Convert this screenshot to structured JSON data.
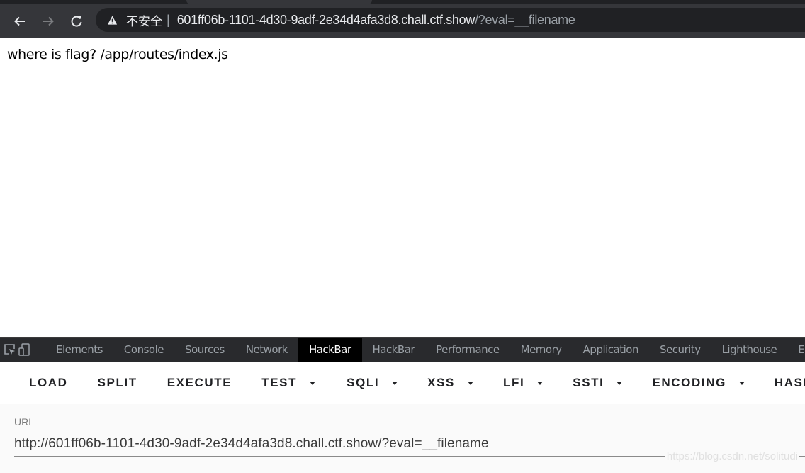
{
  "browser": {
    "security_label": "不安全",
    "separator": "|",
    "url_host": "601ff06b-1101-4d30-9adf-2e34d4afa3d8.chall.ctf.show",
    "url_rest": "/?eval=__filename",
    "icons": {
      "back": "arrow-left",
      "forward": "arrow-right",
      "reload": "refresh",
      "security": "warning-triangle"
    }
  },
  "page": {
    "text": "where is flag? /app/routes/index.js"
  },
  "devtools": {
    "tabs": [
      {
        "label": "Elements",
        "active": false
      },
      {
        "label": "Console",
        "active": false
      },
      {
        "label": "Sources",
        "active": false
      },
      {
        "label": "Network",
        "active": false
      },
      {
        "label": "HackBar",
        "active": true
      },
      {
        "label": "HackBar",
        "active": false
      },
      {
        "label": "Performance",
        "active": false
      },
      {
        "label": "Memory",
        "active": false
      },
      {
        "label": "Application",
        "active": false
      },
      {
        "label": "Security",
        "active": false
      },
      {
        "label": "Lighthouse",
        "active": false
      },
      {
        "label": "EditThisCookie",
        "active": false
      }
    ],
    "hackbar": {
      "buttons": [
        {
          "label": "LOAD"
        },
        {
          "label": "SPLIT"
        },
        {
          "label": "EXECUTE"
        },
        {
          "label": "TEST",
          "dropdown": true
        }
      ],
      "menus": [
        {
          "label": "SQLI",
          "dropdown": true
        },
        {
          "label": "XSS",
          "dropdown": true
        },
        {
          "label": "LFI",
          "dropdown": true
        },
        {
          "label": "SSTI",
          "dropdown": true
        },
        {
          "label": "ENCODING",
          "dropdown": true
        },
        {
          "label": "HASHING",
          "dropdown": true
        }
      ],
      "url_label": "URL",
      "url_value": "http://601ff06b-1101-4d30-9adf-2e34d4afa3d8.chall.ctf.show/?eval=__filename"
    }
  },
  "watermark": "https://blog.csdn.net/solitudi"
}
